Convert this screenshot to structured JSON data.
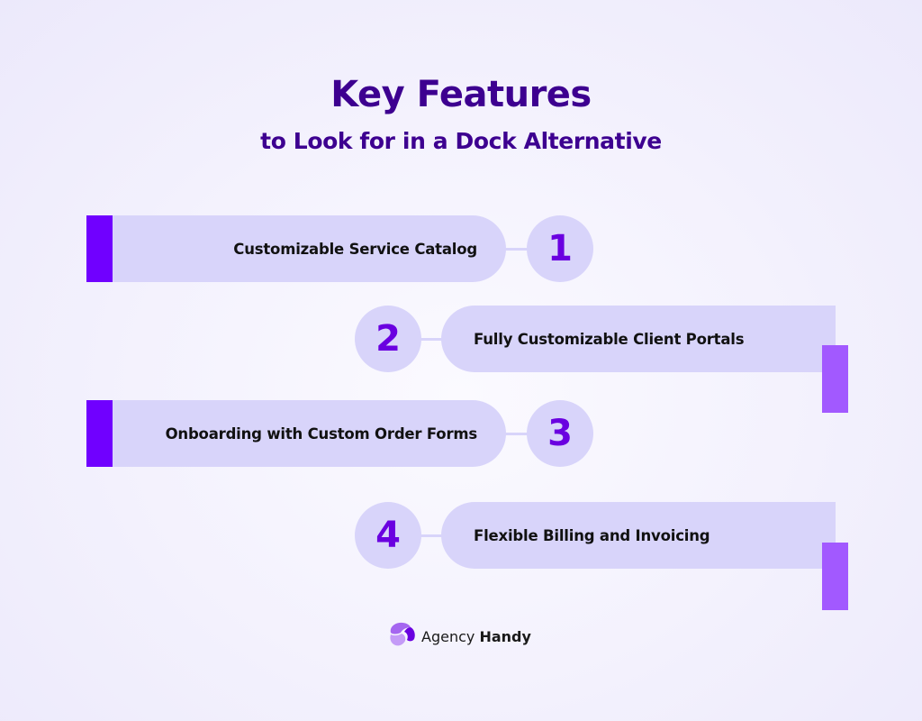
{
  "header": {
    "title": "Key Features",
    "subtitle": "to Look for in a Dock Alternative"
  },
  "features": [
    {
      "number": "1",
      "label": "Customizable Service Catalog",
      "side": "left"
    },
    {
      "number": "2",
      "label": "Fully Customizable Client Portals",
      "side": "right"
    },
    {
      "number": "3",
      "label": "Onboarding with Custom Order Forms",
      "side": "left"
    },
    {
      "number": "4",
      "label": "Flexible Billing and Invoicing",
      "side": "right"
    }
  ],
  "brand": {
    "name_regular": "Agency",
    "name_bold": "Handy",
    "logo_icon": "agency-handy-logo-icon"
  },
  "colors": {
    "title": "#3d0090",
    "card": "#d8d4fa",
    "accent_left": "#7000ff",
    "accent_right": "#a259ff",
    "number": "#6a00e0"
  }
}
